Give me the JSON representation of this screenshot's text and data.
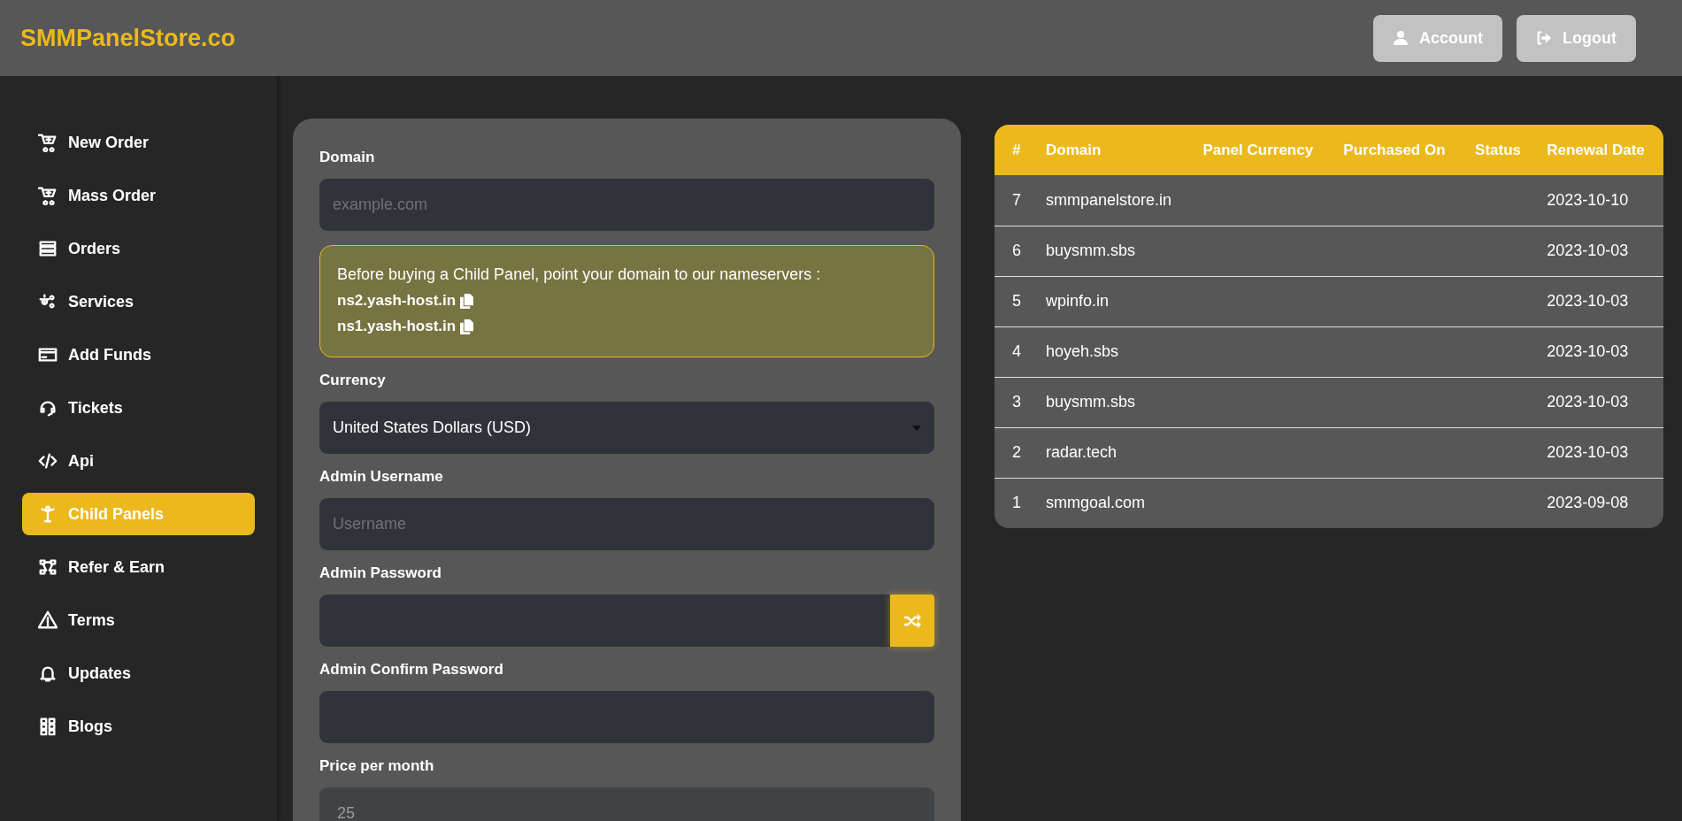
{
  "brand": "SMMPanelStore.co",
  "header": {
    "buttons": [
      {
        "label": "Account",
        "kind": "account"
      },
      {
        "label": "Logout",
        "kind": "logout"
      }
    ]
  },
  "sidebar": {
    "items": [
      {
        "label": "New Order",
        "selected": false
      },
      {
        "label": "Mass Order",
        "selected": false
      },
      {
        "label": "Orders",
        "selected": false
      },
      {
        "label": "Services",
        "selected": false
      },
      {
        "label": "Add Funds",
        "selected": false
      },
      {
        "label": "Tickets",
        "selected": false
      },
      {
        "label": "Api",
        "selected": false
      },
      {
        "label": "Child Panels",
        "selected": true
      },
      {
        "label": "Refer & Earn",
        "selected": false
      },
      {
        "label": "Terms",
        "selected": false
      },
      {
        "label": "Updates",
        "selected": false
      },
      {
        "label": "Blogs",
        "selected": false
      }
    ]
  },
  "form": {
    "fields": [
      {
        "kind": "text",
        "label": "Domain",
        "placeholder": "example.com"
      },
      {
        "kind": "notice",
        "text": "Before buying a Child Panel, point your domain to our nameservers :",
        "nameservers": [
          "ns2.yash-host.in",
          "ns1.yash-host.in"
        ]
      },
      {
        "kind": "select",
        "label": "Currency",
        "value": "United States Dollars (USD)"
      },
      {
        "kind": "text",
        "label": "Admin Username",
        "placeholder": "Username"
      },
      {
        "kind": "password",
        "label": "Admin Password"
      },
      {
        "kind": "text",
        "label": "Admin Confirm Password"
      },
      {
        "kind": "readonly",
        "label": "Price per month",
        "value": "25"
      }
    ]
  },
  "table": {
    "columns": [
      "#",
      "Domain",
      "Panel Currency",
      "Purchased On",
      "Status",
      "Renewal Date"
    ],
    "rows": [
      [
        "7",
        "smmpanelstore.in",
        "",
        "",
        "",
        "2023-10-10"
      ],
      [
        "6",
        "buysmm.sbs",
        "",
        "",
        "",
        "2023-10-03"
      ],
      [
        "5",
        "wpinfo.in",
        "",
        "",
        "",
        "2023-10-03"
      ],
      [
        "4",
        "hoyeh.sbs",
        "",
        "",
        "",
        "2023-10-03"
      ],
      [
        "3",
        "buysmm.sbs",
        "",
        "",
        "",
        "2023-10-03"
      ],
      [
        "2",
        "radar.tech",
        "",
        "",
        "",
        "2023-10-03"
      ],
      [
        "1",
        "smmgoal.com",
        "",
        "",
        "",
        "2023-09-08"
      ]
    ]
  }
}
